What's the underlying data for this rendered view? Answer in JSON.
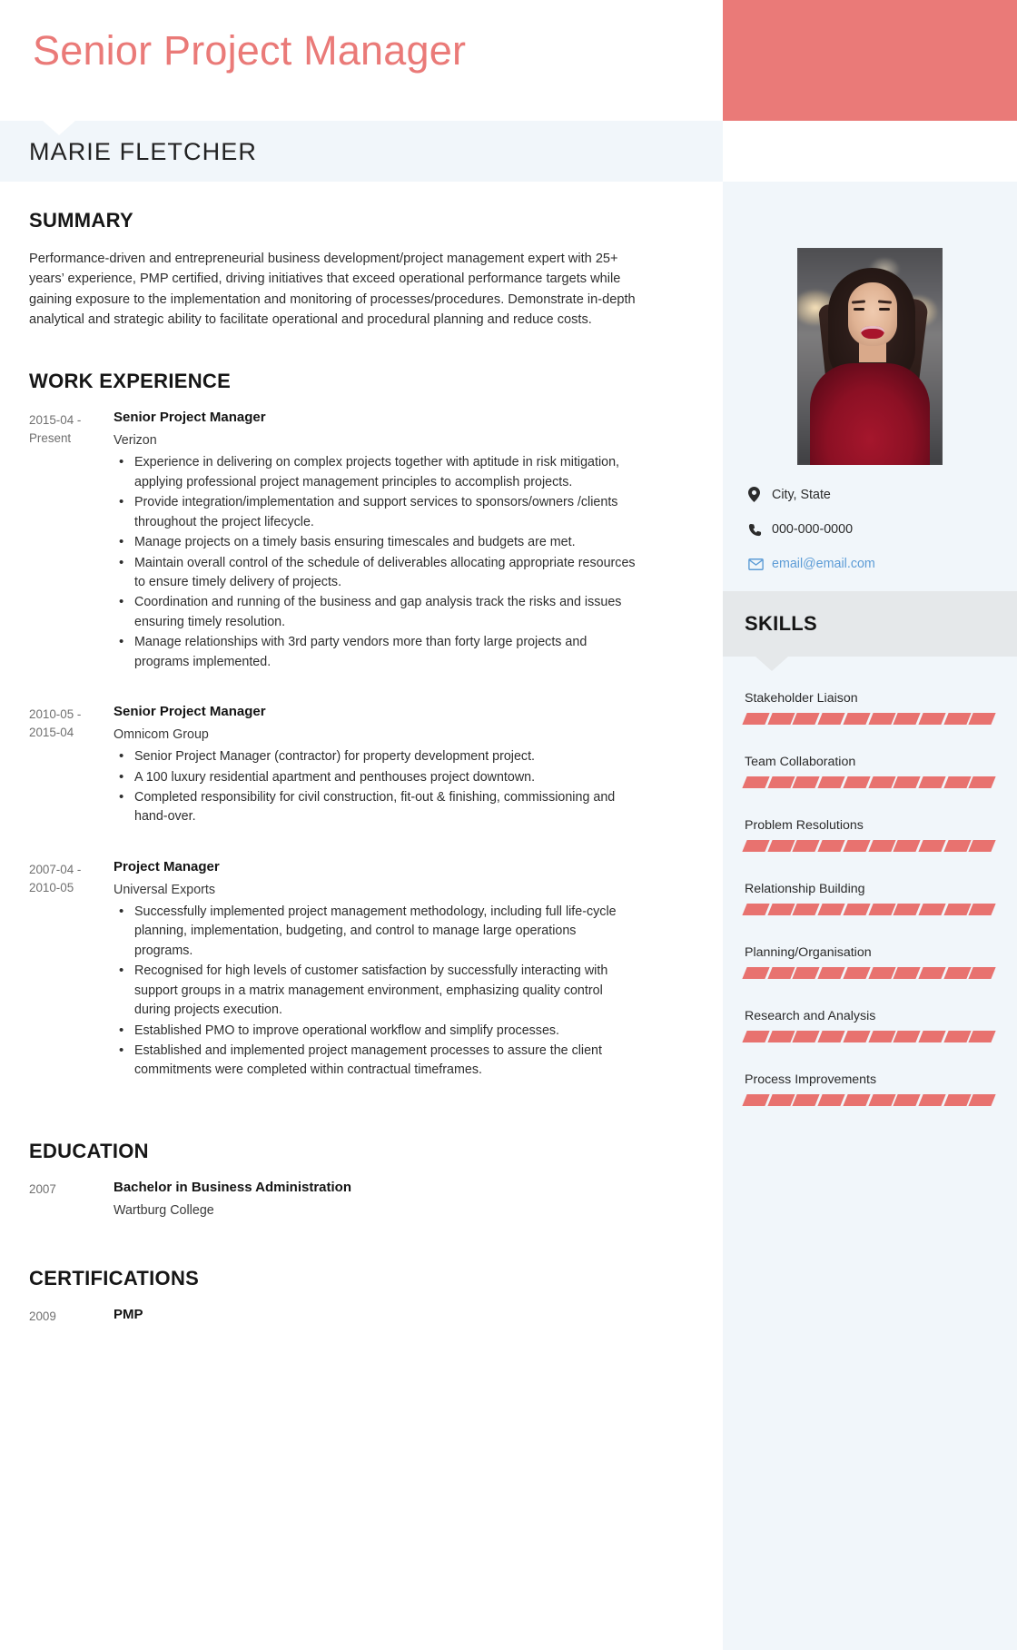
{
  "header": {
    "job_title": "Senior Project Manager",
    "name": "MARIE FLETCHER",
    "accent_color": "#ea7a78",
    "band_color": "#f1f6fa"
  },
  "summary": {
    "heading": "SUMMARY",
    "text": "Performance-driven and entrepreneurial business development/project management expert with 25+ years’ experience, PMP certified, driving initiatives that exceed operational performance targets while gaining exposure to the implementation and monitoring of processes/procedures. Demonstrate in-depth analytical and strategic ability to facilitate operational and procedural planning and reduce costs."
  },
  "work": {
    "heading": "WORK EXPERIENCE",
    "entries": [
      {
        "dates": "2015-04 - Present",
        "role": "Senior Project Manager",
        "company": "Verizon",
        "bullets": [
          "Experience in delivering on complex projects together with aptitude in risk mitigation, applying professional project management principles to accomplish projects.",
          "Provide integration/implementation and support services to sponsors/owners /clients throughout the project lifecycle.",
          "Manage projects on a timely basis ensuring timescales and budgets are met.",
          "Maintain overall control of the schedule of deliverables allocating appropriate resources to ensure timely delivery of projects.",
          "Coordination and running of the business and gap analysis track the risks and issues ensuring timely resolution.",
          "Manage relationships with 3rd party vendors more than forty large projects and programs implemented."
        ]
      },
      {
        "dates": "2010-05 - 2015-04",
        "role": "Senior Project Manager",
        "company": "Omnicom Group",
        "bullets": [
          "Senior Project Manager (contractor) for property development project.",
          "A 100 luxury residential apartment and penthouses project downtown.",
          "Completed responsibility for civil construction, fit-out & finishing, commissioning and hand-over."
        ]
      },
      {
        "dates": "2007-04 - 2010-05",
        "role": "Project Manager",
        "company": "Universal Exports",
        "bullets": [
          "Successfully implemented project management methodology, including full life-cycle planning, implementation, budgeting, and control to manage large operations programs.",
          "Recognised for high levels of customer satisfaction by successfully interacting with support groups in a matrix management environment, emphasizing quality control during projects execution.",
          "Established PMO to improve operational workflow and simplify processes.",
          "Established and implemented project management processes to assure the client commitments were completed within contractual timeframes."
        ]
      }
    ]
  },
  "education": {
    "heading": "EDUCATION",
    "entries": [
      {
        "dates": "2007",
        "degree": "Bachelor in Business Administration",
        "school": "Wartburg College"
      }
    ]
  },
  "certifications": {
    "heading": "CERTIFICATIONS",
    "entries": [
      {
        "dates": "2009",
        "title": "PMP"
      }
    ]
  },
  "sidebar": {
    "contacts": [
      {
        "icon": "location-pin-icon",
        "value": "City, State"
      },
      {
        "icon": "phone-icon",
        "value": "000-000-0000"
      },
      {
        "icon": "envelope-icon",
        "value": "email@email.com"
      }
    ],
    "skills_heading": "SKILLS",
    "skills_band_color": "#e5e8ea",
    "skill_bar_color": "#e8726f",
    "skill_bar_total_segments": 10,
    "skills": [
      {
        "name": "Stakeholder Liaison",
        "filled": 10
      },
      {
        "name": "Team Collaboration",
        "filled": 10
      },
      {
        "name": "Problem Resolutions",
        "filled": 10
      },
      {
        "name": "Relationship Building",
        "filled": 10
      },
      {
        "name": "Planning/Organisation",
        "filled": 10
      },
      {
        "name": "Research and Analysis",
        "filled": 10
      },
      {
        "name": "Process Improvements",
        "filled": 10
      }
    ]
  }
}
